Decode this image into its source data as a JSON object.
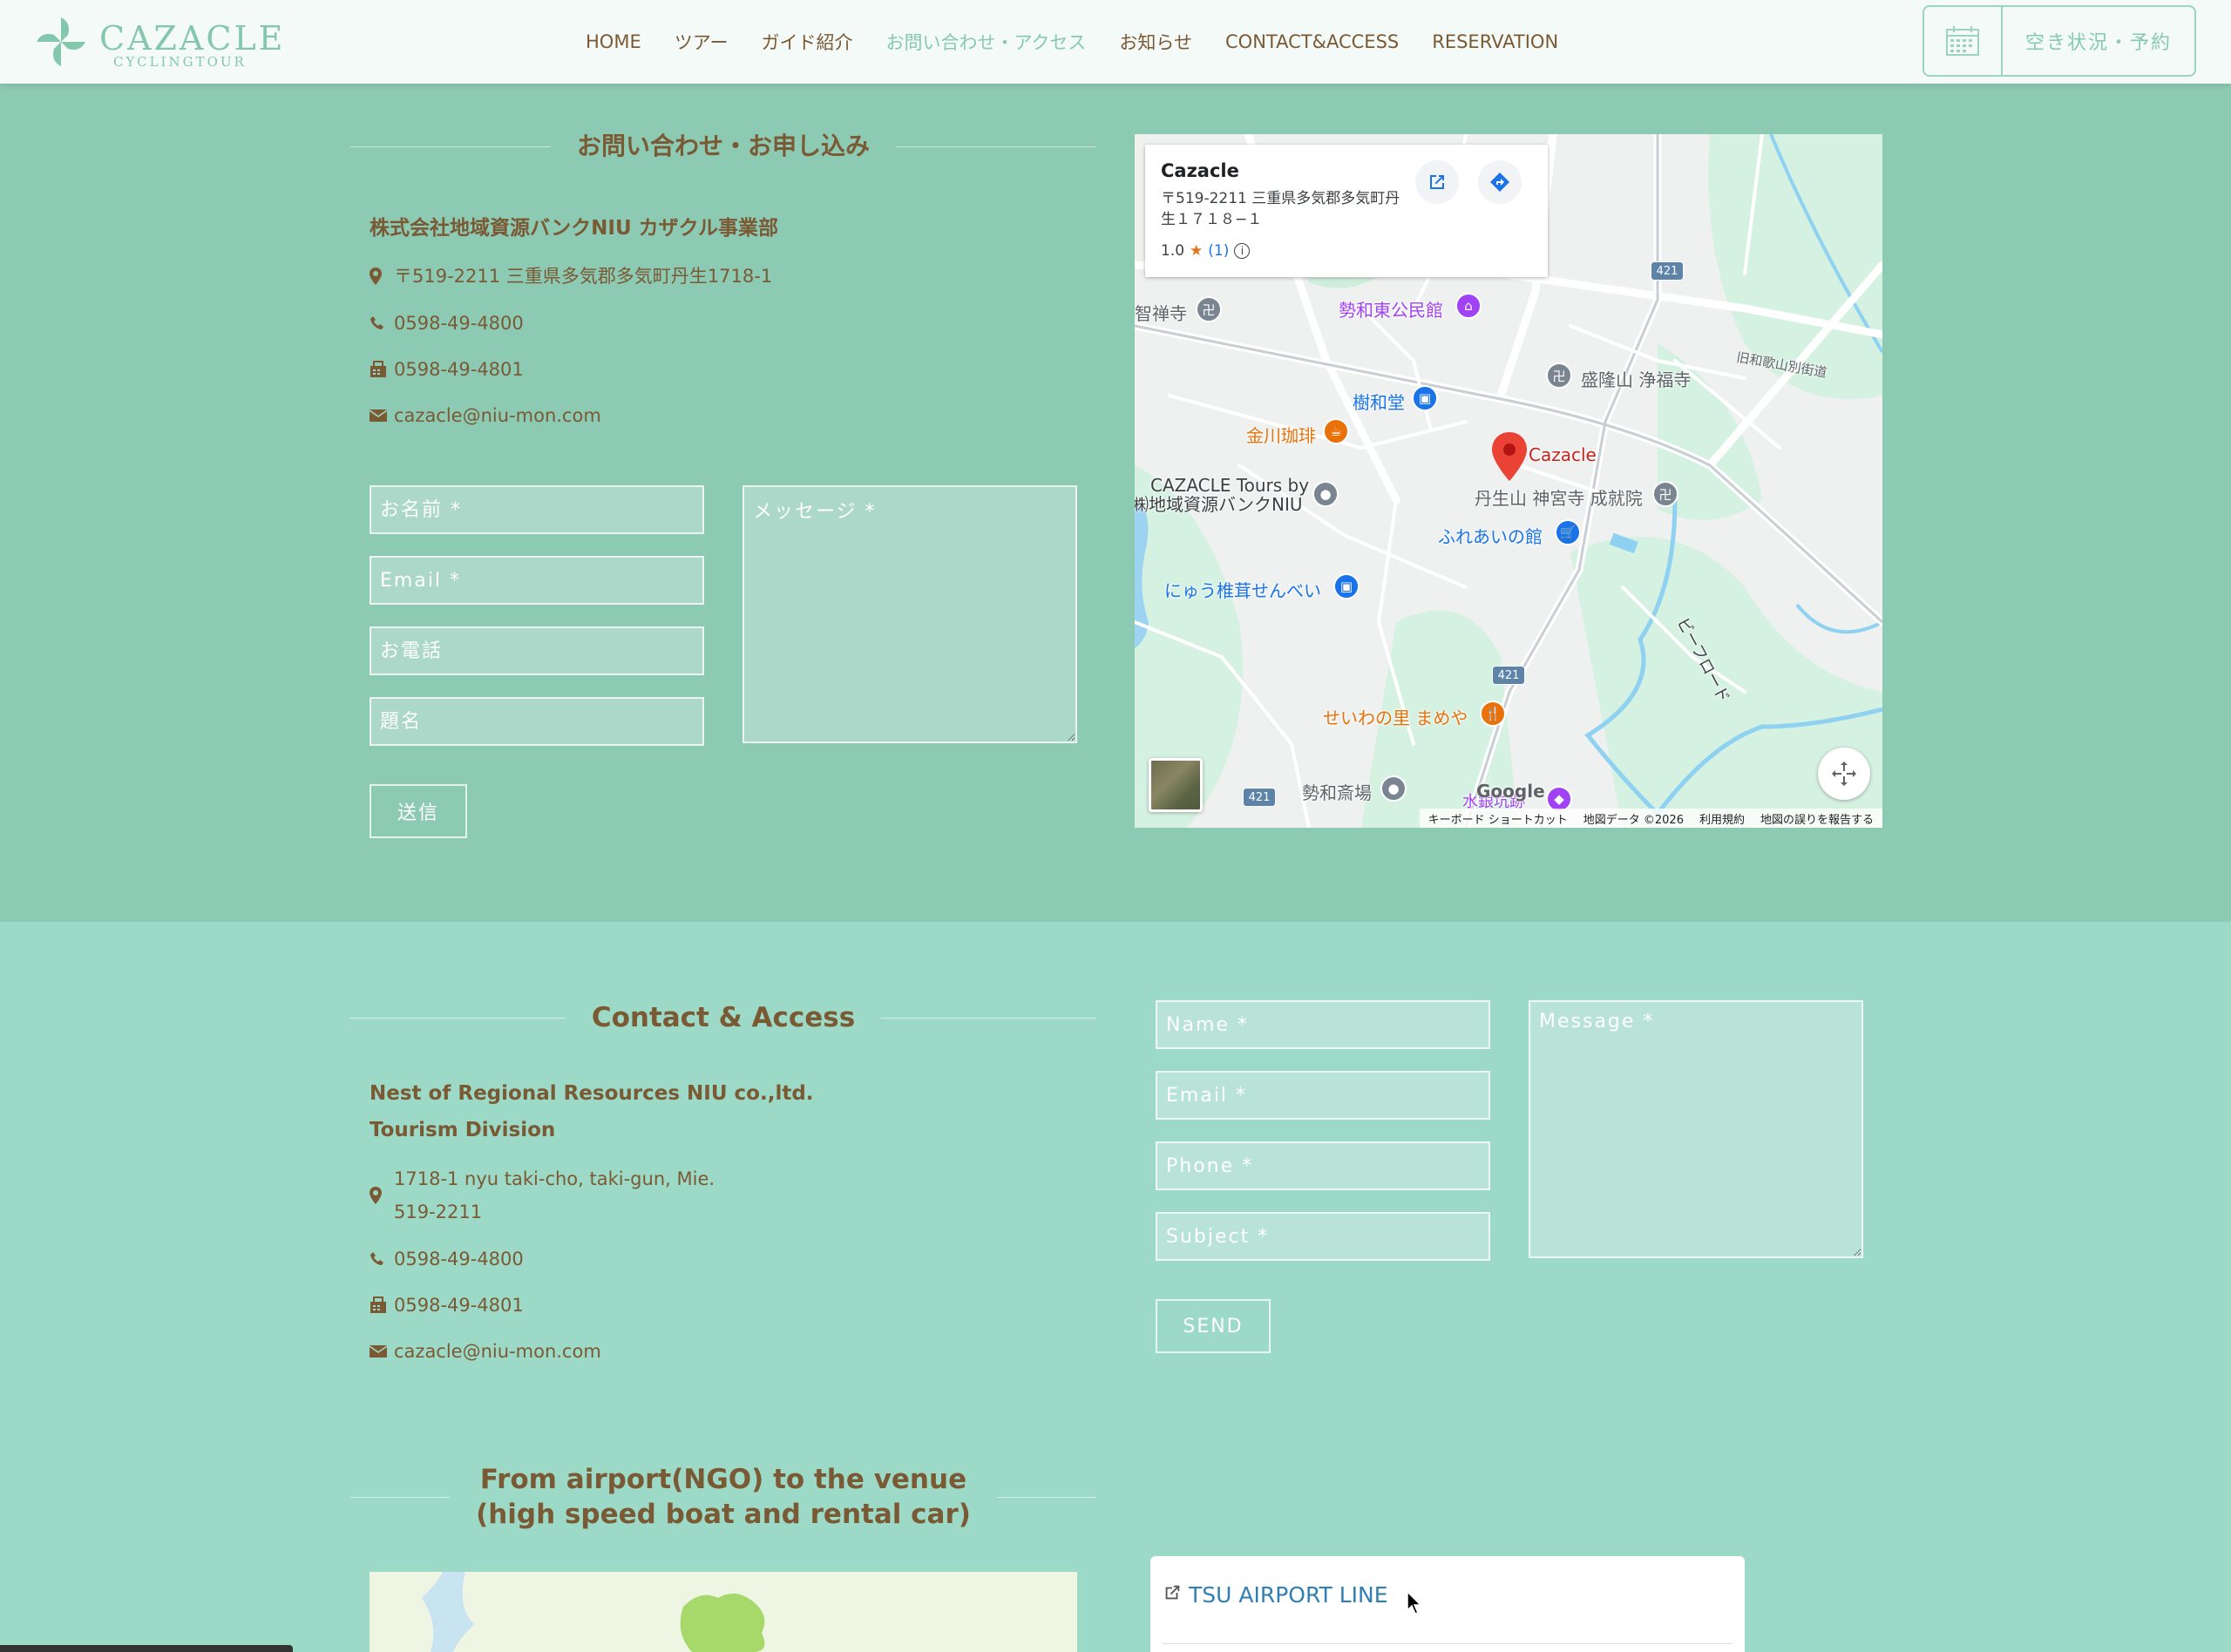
{
  "header": {
    "logo": {
      "name": "CAZACLE",
      "sub": "CYCLINGTOUR"
    },
    "nav": [
      {
        "label": "HOME",
        "active": false
      },
      {
        "label": "ツアー",
        "active": false
      },
      {
        "label": "ガイド紹介",
        "active": false
      },
      {
        "label": "お問い合わせ・アクセス",
        "active": true
      },
      {
        "label": "お知らせ",
        "active": false
      },
      {
        "label": "CONTACT&ACCESS",
        "active": false
      },
      {
        "label": "RESERVATION",
        "active": false
      }
    ],
    "reserve_label": "空き状況・予約"
  },
  "jp_contact": {
    "title": "お問い合わせ・お申し込み",
    "company": "株式会社地域資源バンクNIU カザクル事業部",
    "address": "〒519-2211 三重県多気郡多気町丹生1718-1",
    "phone": "0598-49-4800",
    "fax": "0598-49-4801",
    "email": "cazacle@niu-mon.com",
    "form": {
      "name_ph": "お名前 *",
      "email_ph": "Email *",
      "phone_ph": "お電話",
      "subject_ph": "題名",
      "message_ph": "メッセージ *",
      "submit": "送信"
    }
  },
  "map": {
    "place_name": "Cazacle",
    "place_address": "〒519-2211 三重県多気郡多気町丹生１７１８−１",
    "rating": "1.0",
    "rating_count": "(1)",
    "labels": {
      "chishinji": "智禅寺",
      "seiwa_kominkan": "勢和東公民館",
      "jyuwado": "樹和堂",
      "kanagawa_coffee": "金川珈琲",
      "seiryuzan": "盛隆山 浄福寺",
      "cazacle": "Cazacle",
      "cazacle_tours": "CAZACLE Tours by",
      "cazacle_tours2": "㈱地域資源バンクNIU",
      "niusan": "丹生山 神宮寺 成就院",
      "fureai": "ふれあいの館",
      "shiitake": "にゅう椎茸せんべい",
      "mameya": "せいわの里 まめや",
      "saijo": "勢和斎場",
      "suigin": "水銀坑跡",
      "old_road": "旧和歌山別街道",
      "beer_road": "ビーフロード",
      "route": "421"
    },
    "google": "Google",
    "footer": [
      "キーボード ショートカット",
      "地図データ ©2026",
      "利用規約",
      "地図の誤りを報告する"
    ]
  },
  "en_contact": {
    "title": "Contact & Access",
    "company_line1": "Nest of Regional Resources NIU co.,ltd.",
    "company_line2": "Tourism Division",
    "address_line1": "1718-1 nyu taki-cho, taki-gun, Mie.",
    "address_line2": "519-2211",
    "phone": "0598-49-4800",
    "fax": "0598-49-4801",
    "email": "cazacle@niu-mon.com",
    "form": {
      "name_ph": "Name *",
      "email_ph": "Email *",
      "phone_ph": "Phone *",
      "subject_ph": "Subject *",
      "message_ph": "Message *",
      "submit": "SEND"
    }
  },
  "airport": {
    "title_line1": "From airport(NGO) to the venue",
    "title_line2": "(high speed boat and rental car)",
    "link": "TSU AIRPORT LINE"
  }
}
